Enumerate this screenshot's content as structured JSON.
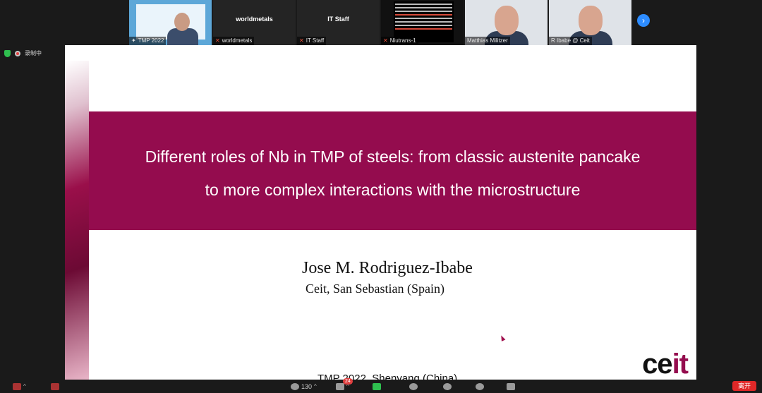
{
  "participants": [
    {
      "name": "TMP 2022",
      "muted": false,
      "kind": "screen"
    },
    {
      "name": "worldmetals",
      "display": "worldmetals",
      "muted": true,
      "kind": "name"
    },
    {
      "name": "IT Staff",
      "display": "IT Staff",
      "muted": true,
      "kind": "name"
    },
    {
      "name": "Niutrans-1",
      "muted": true,
      "kind": "text"
    },
    {
      "name": "Matthias Militzer",
      "muted": false,
      "kind": "video"
    },
    {
      "name": "R Ibabe @ Ceit",
      "muted": false,
      "kind": "video"
    }
  ],
  "recording": {
    "label": "录制中"
  },
  "slide": {
    "title_line1": "Different roles of Nb in TMP of steels: from classic austenite pancake",
    "title_line2": "to more complex interactions with the microstructure",
    "author": "Jose M. Rodriguez-Ibabe",
    "affiliation": "Ceit, San Sebastian (Spain)",
    "footer": "TMP 2022, Shenyang (China)",
    "logo_main": "ce",
    "logo_accent": "it",
    "colors": {
      "banner": "#940c4e",
      "background": "#ffffff"
    }
  },
  "toolbar": {
    "participants_count": "130",
    "chat_badge": "24",
    "leave_label": "离开"
  }
}
